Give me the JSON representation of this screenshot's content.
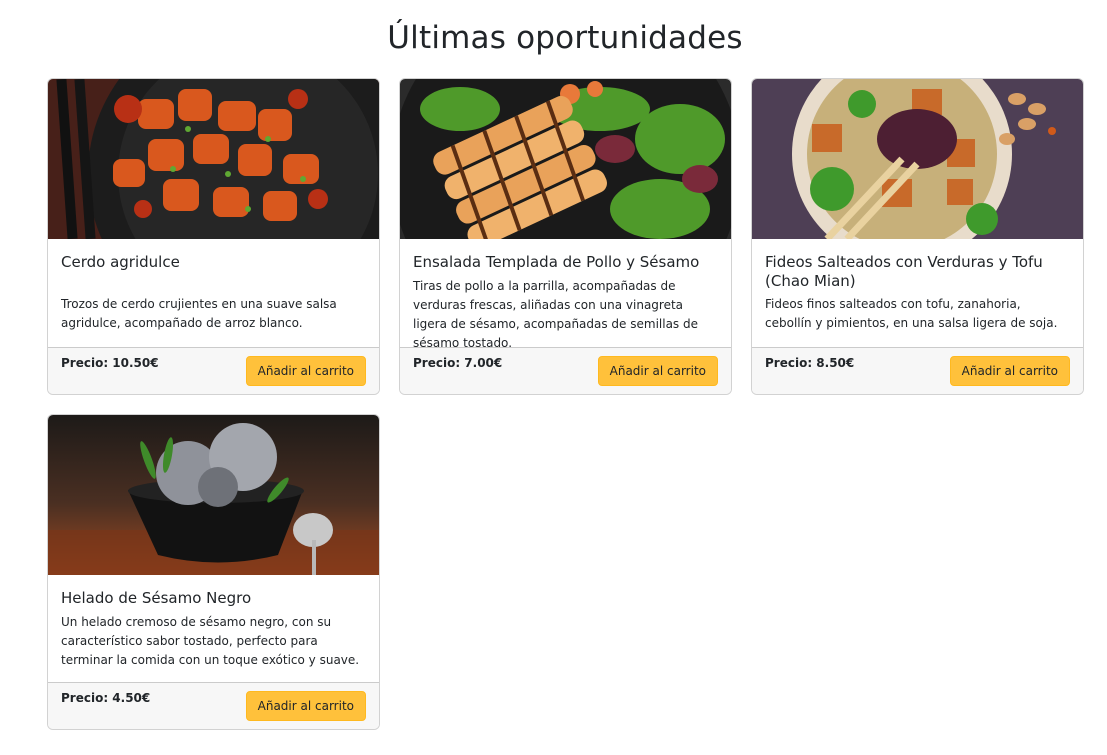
{
  "page": {
    "title": "Últimas oportunidades"
  },
  "colors": {
    "accent": "#ffc13b",
    "footer_bg": "#f7f7f7",
    "text": "#212529"
  },
  "products": [
    {
      "name": "Cerdo agridulce",
      "description": "Trozos de cerdo crujientes en una suave salsa agridulce, acompañado de arroz blanco.",
      "price": "Precio: 10.50€",
      "button": "Añadir al carrito"
    },
    {
      "name": "Ensalada Templada de Pollo y Sésamo",
      "description": "Tiras de pollo a la parrilla, acompañadas de verduras frescas, aliñadas con una vinagreta ligera de sésamo, acompañadas de semillas de sésamo tostado.",
      "price": "Precio: 7.00€",
      "button": "Añadir al carrito"
    },
    {
      "name": "Fideos Salteados con Verduras y Tofu (Chao Mian)",
      "description": "Fideos finos salteados con tofu, zanahoria, cebollín y pimientos, en una salsa ligera de soja.",
      "price": "Precio: 8.50€",
      "button": "Añadir al carrito"
    },
    {
      "name": "Helado de Sésamo Negro",
      "description": "Un helado cremoso de sésamo negro, con su característico sabor tostado, perfecto para terminar la comida con un toque exótico y suave.",
      "price": "Precio: 4.50€",
      "button": "Añadir al carrito"
    }
  ]
}
